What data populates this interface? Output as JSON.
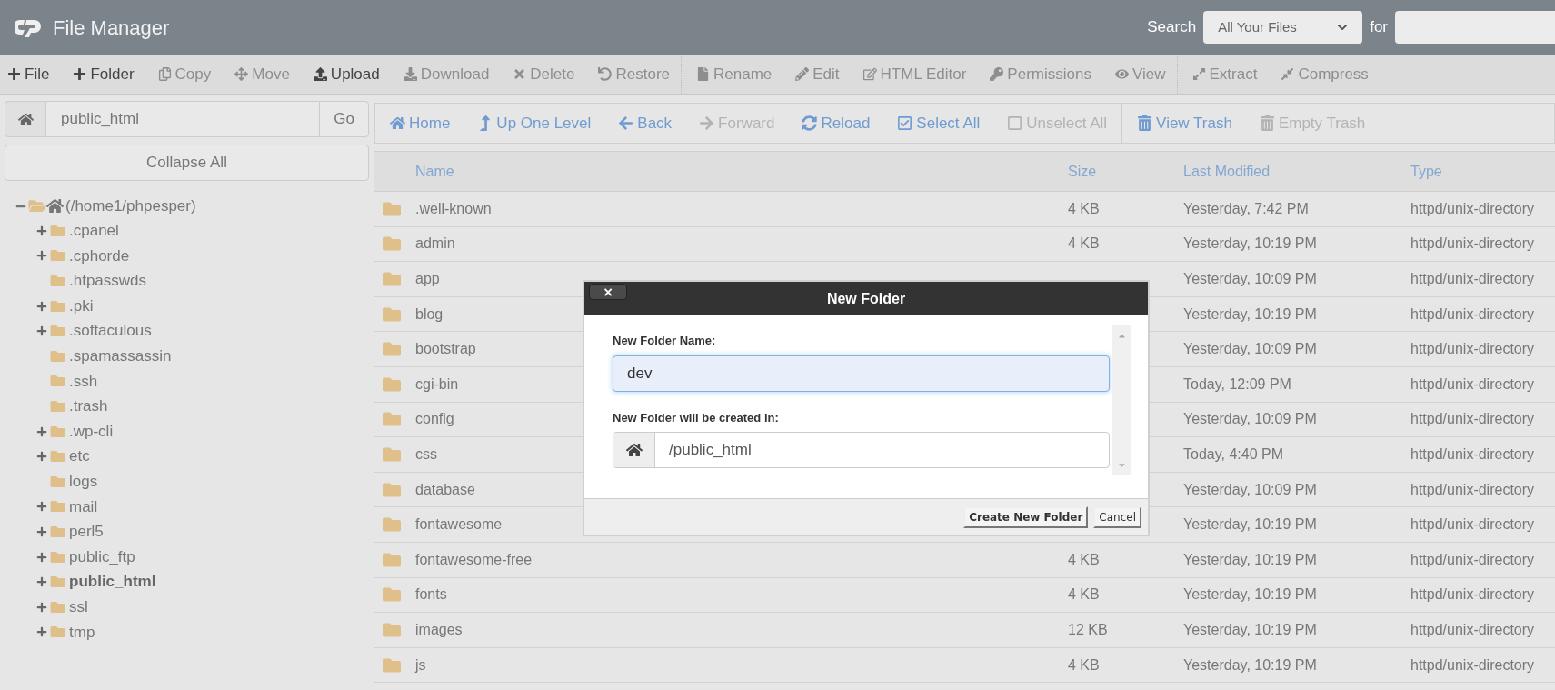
{
  "header": {
    "title": "File Manager",
    "search_label": "Search",
    "search_scope": "All Your Files",
    "for_label": "for"
  },
  "toolbar": {
    "groups": [
      {
        "items": [
          {
            "label": "File",
            "disabled": false
          },
          {
            "label": "Folder",
            "disabled": false
          },
          {
            "label": "Copy",
            "disabled": true
          },
          {
            "label": "Move",
            "disabled": true
          },
          {
            "label": "Upload",
            "disabled": false
          },
          {
            "label": "Download",
            "disabled": true
          },
          {
            "label": "Delete",
            "disabled": true
          },
          {
            "label": "Restore",
            "disabled": true
          }
        ]
      },
      {
        "items": [
          {
            "label": "Rename",
            "disabled": true
          },
          {
            "label": "Edit",
            "disabled": true
          },
          {
            "label": "HTML Editor",
            "disabled": true
          },
          {
            "label": "Permissions",
            "disabled": true
          },
          {
            "label": "View",
            "disabled": true
          }
        ]
      },
      {
        "items": [
          {
            "label": "Extract",
            "disabled": true
          },
          {
            "label": "Compress",
            "disabled": true
          }
        ]
      }
    ]
  },
  "sidebar": {
    "path": "public_html",
    "go": "Go",
    "collapse": "Collapse All",
    "tree": {
      "label": "(/home1/phpesper)",
      "expanded": true,
      "children": [
        {
          "label": ".cpanel",
          "expandable": true,
          "selected": false
        },
        {
          "label": ".cphorde",
          "expandable": true,
          "selected": false
        },
        {
          "label": ".htpasswds",
          "expandable": false,
          "selected": false
        },
        {
          "label": ".pki",
          "expandable": true,
          "selected": false
        },
        {
          "label": ".softaculous",
          "expandable": true,
          "selected": false
        },
        {
          "label": ".spamassassin",
          "expandable": false,
          "selected": false
        },
        {
          "label": ".ssh",
          "expandable": false,
          "selected": false
        },
        {
          "label": ".trash",
          "expandable": false,
          "selected": false
        },
        {
          "label": ".wp-cli",
          "expandable": true,
          "selected": false
        },
        {
          "label": "etc",
          "expandable": true,
          "selected": false
        },
        {
          "label": "logs",
          "expandable": false,
          "selected": false
        },
        {
          "label": "mail",
          "expandable": true,
          "selected": false
        },
        {
          "label": "perl5",
          "expandable": true,
          "selected": false
        },
        {
          "label": "public_ftp",
          "expandable": true,
          "selected": false
        },
        {
          "label": "public_html",
          "expandable": true,
          "selected": true
        },
        {
          "label": "ssl",
          "expandable": true,
          "selected": false
        },
        {
          "label": "tmp",
          "expandable": true,
          "selected": false
        }
      ]
    }
  },
  "nav": {
    "groups": [
      {
        "items": [
          {
            "label": "Home",
            "disabled": false
          },
          {
            "label": "Up One Level",
            "disabled": false
          },
          {
            "label": "Back",
            "disabled": false
          },
          {
            "label": "Forward",
            "disabled": true
          },
          {
            "label": "Reload",
            "disabled": false
          },
          {
            "label": "Select All",
            "disabled": false
          },
          {
            "label": "Unselect All",
            "disabled": true
          }
        ]
      },
      {
        "items": [
          {
            "label": "View Trash",
            "disabled": false
          },
          {
            "label": "Empty Trash",
            "disabled": true
          }
        ]
      }
    ]
  },
  "table": {
    "columns": [
      "Name",
      "Size",
      "Last Modified",
      "Type"
    ],
    "rows": [
      {
        "name": ".well-known",
        "size": "4 KB",
        "modified": "Yesterday, 7:42 PM",
        "type": "httpd/unix-directory"
      },
      {
        "name": "admin",
        "size": "4 KB",
        "modified": "Yesterday, 10:19 PM",
        "type": "httpd/unix-directory"
      },
      {
        "name": "app",
        "modified": "Yesterday, 10:09 PM",
        "type": "httpd/unix-directory"
      },
      {
        "name": "blog",
        "modified": "Yesterday, 10:19 PM",
        "type": "httpd/unix-directory"
      },
      {
        "name": "bootstrap",
        "modified": "Yesterday, 10:09 PM",
        "type": "httpd/unix-directory"
      },
      {
        "name": "cgi-bin",
        "modified": "Today, 12:09 PM",
        "type": "httpd/unix-directory"
      },
      {
        "name": "config",
        "modified": "Yesterday, 10:09 PM",
        "type": "httpd/unix-directory"
      },
      {
        "name": "css",
        "modified": "Today, 4:40 PM",
        "type": "httpd/unix-directory"
      },
      {
        "name": "database",
        "modified": "Yesterday, 10:09 PM",
        "type": "httpd/unix-directory"
      },
      {
        "name": "fontawesome",
        "modified": "Yesterday, 10:19 PM",
        "type": "httpd/unix-directory"
      },
      {
        "name": "fontawesome-free",
        "size": "4 KB",
        "modified": "Yesterday, 10:19 PM",
        "type": "httpd/unix-directory"
      },
      {
        "name": "fonts",
        "size": "4 KB",
        "modified": "Yesterday, 10:19 PM",
        "type": "httpd/unix-directory"
      },
      {
        "name": "images",
        "size": "12 KB",
        "modified": "Yesterday, 10:19 PM",
        "type": "httpd/unix-directory"
      },
      {
        "name": "js",
        "size": "4 KB",
        "modified": "Yesterday, 10:19 PM",
        "type": "httpd/unix-directory"
      }
    ]
  },
  "dialog": {
    "title": "New Folder",
    "close": "×",
    "name_label": "New Folder Name:",
    "name_value": "dev",
    "location_label": "New Folder will be created in:",
    "location_value": "/public_html",
    "buttons": [
      "Create New Folder",
      "Cancel"
    ]
  }
}
